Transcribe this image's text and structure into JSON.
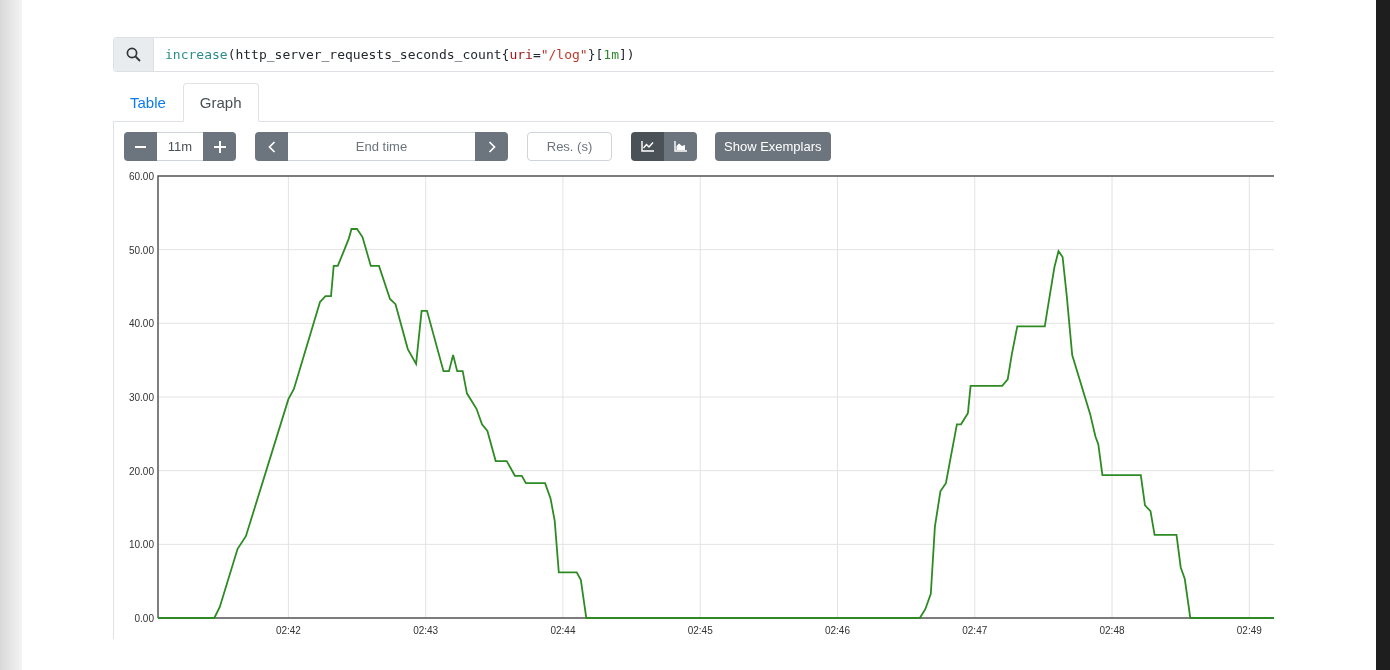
{
  "query": {
    "tokens": [
      {
        "kind": "function",
        "text": "increase"
      },
      {
        "kind": "plain",
        "text": "(http_server_requests_seconds_count{"
      },
      {
        "kind": "label",
        "text": "uri"
      },
      {
        "kind": "plain",
        "text": "="
      },
      {
        "kind": "string",
        "text": "\"/log\""
      },
      {
        "kind": "plain",
        "text": "}["
      },
      {
        "kind": "number",
        "text": "1m"
      },
      {
        "kind": "plain",
        "text": "])"
      }
    ]
  },
  "tabs": [
    {
      "label": "Table",
      "selected": false
    },
    {
      "label": "Graph",
      "selected": true
    }
  ],
  "toolbar": {
    "range_value": "11m",
    "end_time_placeholder": "End time",
    "resolution_placeholder": "Res. (s)",
    "chart_modes": [
      {
        "kind": "lines",
        "selected": true
      },
      {
        "kind": "stacked",
        "selected": false
      }
    ],
    "exemplars_button": "Show Exemplars"
  },
  "graph": {
    "chart_data": {
      "type": "line",
      "x": [
        161.05,
        161.46,
        161.5,
        161.63,
        161.69,
        162.0,
        162.04,
        162.23,
        162.27,
        162.31,
        162.33,
        162.36,
        162.41,
        162.44,
        162.46,
        162.5,
        162.54,
        162.6,
        162.66,
        162.74,
        162.78,
        162.87,
        162.93,
        162.97,
        163.01,
        163.13,
        163.17,
        163.2,
        163.23,
        163.27,
        163.3,
        163.37,
        163.41,
        163.45,
        163.51,
        163.59,
        163.65,
        163.7,
        163.73,
        163.87,
        163.91,
        163.94,
        163.97,
        164.1,
        164.13,
        164.17,
        166.6,
        166.64,
        166.68,
        166.71,
        166.75,
        166.79,
        166.83,
        166.87,
        166.9,
        166.95,
        166.97,
        167.2,
        167.24,
        167.27,
        167.31,
        167.51,
        167.53,
        167.58,
        167.61,
        167.64,
        167.67,
        167.71,
        167.84,
        167.88,
        167.9,
        167.93,
        168.21,
        168.24,
        168.28,
        168.31,
        168.47,
        168.5,
        168.53,
        168.57,
        169.18
      ],
      "series": [
        {
          "color": "#2e8b23",
          "values": [
            0,
            0,
            1.5,
            9.4,
            11.1,
            29.7,
            31.1,
            42.9,
            43.7,
            43.7,
            47.8,
            47.8,
            50.1,
            51.5,
            52.8,
            52.8,
            51.7,
            47.8,
            47.8,
            43.3,
            42.6,
            36.5,
            34.5,
            41.7,
            41.7,
            33.5,
            33.5,
            35.7,
            33.5,
            33.5,
            30.5,
            28.4,
            26.3,
            25.4,
            21.3,
            21.3,
            19.3,
            19.3,
            18.3,
            18.3,
            16.2,
            13.2,
            6.2,
            6.2,
            5.2,
            0,
            0,
            1.2,
            3.3,
            12.4,
            17.2,
            18.3,
            22.3,
            26.3,
            26.3,
            27.8,
            31.5,
            31.5,
            32.4,
            35.8,
            39.6,
            39.6,
            41.9,
            47.6,
            49.8,
            49.0,
            43.8,
            35.7,
            27.7,
            24.6,
            23.6,
            19.4,
            19.4,
            15.3,
            14.5,
            11.3,
            11.3,
            6.9,
            5.3,
            0,
            0
          ]
        }
      ],
      "grid": true,
      "xlim": [
        161.05,
        169.18
      ],
      "ylim": [
        0,
        60
      ],
      "xticks": [
        {
          "value": 162,
          "label": "02:42"
        },
        {
          "value": 163,
          "label": "02:43"
        },
        {
          "value": 164,
          "label": "02:44"
        },
        {
          "value": 165,
          "label": "02:45"
        },
        {
          "value": 166,
          "label": "02:46"
        },
        {
          "value": 167,
          "label": "02:47"
        },
        {
          "value": 168,
          "label": "02:48"
        },
        {
          "value": 169,
          "label": "02:49"
        }
      ],
      "yticks": [
        {
          "value": 0,
          "label": "0.00"
        },
        {
          "value": 10,
          "label": "10.00"
        },
        {
          "value": 20,
          "label": "20.00"
        },
        {
          "value": 30,
          "label": "30.00"
        },
        {
          "value": 40,
          "label": "40.00"
        },
        {
          "value": 50,
          "label": "50.00"
        },
        {
          "value": 60,
          "label": "60.00"
        }
      ]
    }
  }
}
